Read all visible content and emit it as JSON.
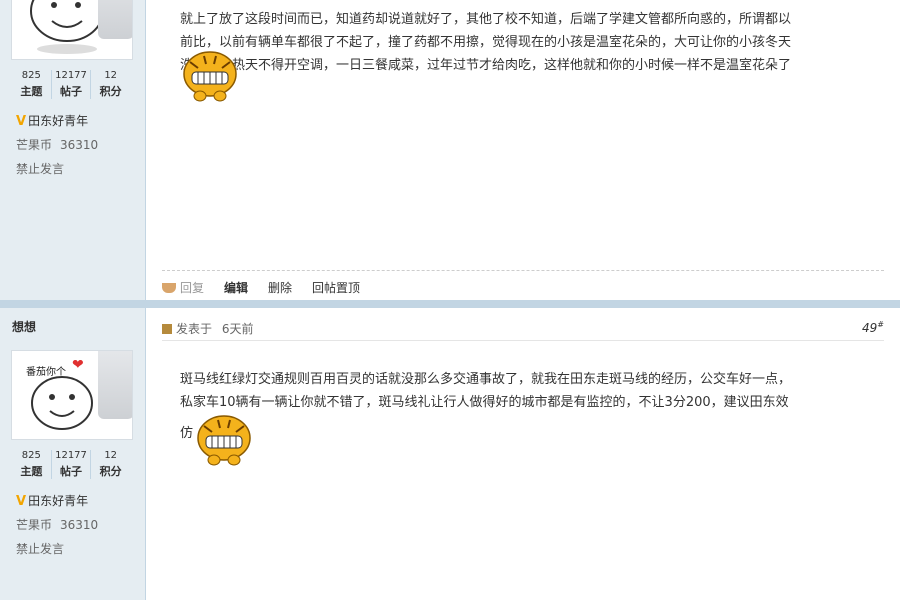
{
  "post1": {
    "author": {
      "stats": [
        {
          "num": "825",
          "label": "主题"
        },
        {
          "num": "12177",
          "label": "帖子"
        },
        {
          "num": "12",
          "label": "积分"
        }
      ],
      "title": "田东好青年",
      "currency_label": "芒果币",
      "currency_value": "36310",
      "status": "禁止发言"
    },
    "text_line1": "就上了放了这段时间而已，知道药却说道就好了，其他了校不知道，后端了学建文管都所向惑的，所谓都以",
    "text_line2": "前比，以前有辆单车都很了不起了，撞了药都不用擦，觉得现在的小孩是温室花朵的，大可让你的小孩冬天",
    "text_line3": "洗冷水，热天不得开空调，一日三餐咸菜，过年过节才给肉吃，这样他就和你的小时候一样不是温室花朵了",
    "actions": {
      "reply": "回复",
      "edit": "编辑",
      "delete": "删除",
      "pin": "回帖置顶"
    }
  },
  "post2": {
    "author": {
      "name": "想想",
      "avatar_text": "番茄你个",
      "stats": [
        {
          "num": "825",
          "label": "主题"
        },
        {
          "num": "12177",
          "label": "帖子"
        },
        {
          "num": "12",
          "label": "积分"
        }
      ],
      "title": "田东好青年",
      "currency_label": "芒果币",
      "currency_value": "36310",
      "status": "禁止发言"
    },
    "posted_label": "发表于",
    "posted_time": "6天前",
    "floor_num": "49",
    "floor_sup": "#",
    "text_line1": "斑马线红绿灯交通规则百用百灵的话就没那么多交通事故了，就我在田东走斑马线的经历，公交车好一点，",
    "text_line2": "私家车10辆有一辆让你就不错了，斑马线礼让行人做得好的城市都是有监控的，不让3分200，建议田东效",
    "text_line3": "仿"
  },
  "colors": {
    "sidebar_bg": "#e5edf2",
    "separator": "#c2d5e3",
    "title_icon": "#f2a500"
  }
}
